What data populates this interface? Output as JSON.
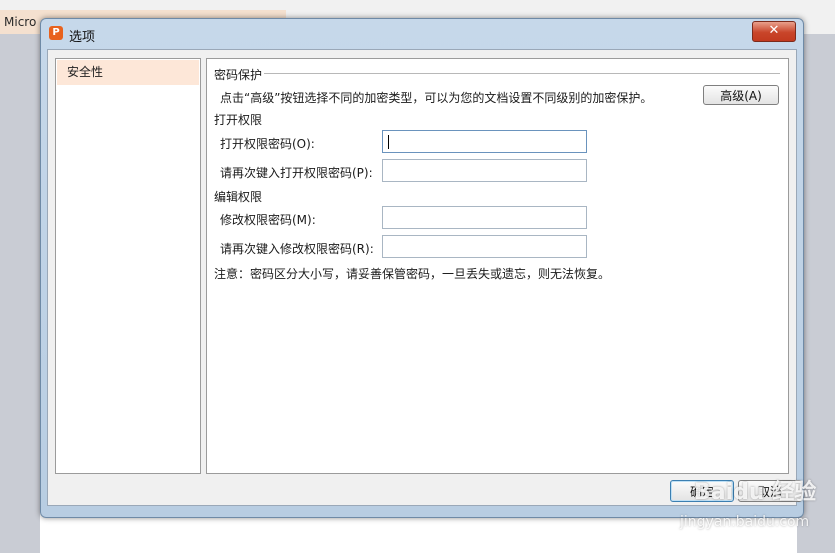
{
  "app": {
    "title": "Micro"
  },
  "dialog": {
    "title": "选项",
    "close_label": "✕"
  },
  "nav": {
    "items": [
      {
        "label": "安全性",
        "selected": true
      }
    ]
  },
  "security": {
    "section_title": "密码保护",
    "description": "点击“高级”按钮选择不同的加密类型，可以为您的文档设置不同级别的加密保护。",
    "advanced_button": "高级(A)",
    "open_group": "打开权限",
    "open_password_label": "打开权限密码(O):",
    "open_password_value": "",
    "open_confirm_label": "请再次键入打开权限密码(P):",
    "open_confirm_value": "",
    "edit_group": "编辑权限",
    "modify_password_label": "修改权限密码(M):",
    "modify_password_value": "",
    "modify_confirm_label": "请再次键入修改权限密码(R):",
    "modify_confirm_value": "",
    "note": "注意：密码区分大小写，请妥善保管密码，一旦丢失或遗忘，则无法恢复。"
  },
  "footer": {
    "ok_label": "确定",
    "cancel_label": "取消"
  },
  "watermark": {
    "logo": "Baidu 经验",
    "url": "jingyan.baidu.com"
  }
}
